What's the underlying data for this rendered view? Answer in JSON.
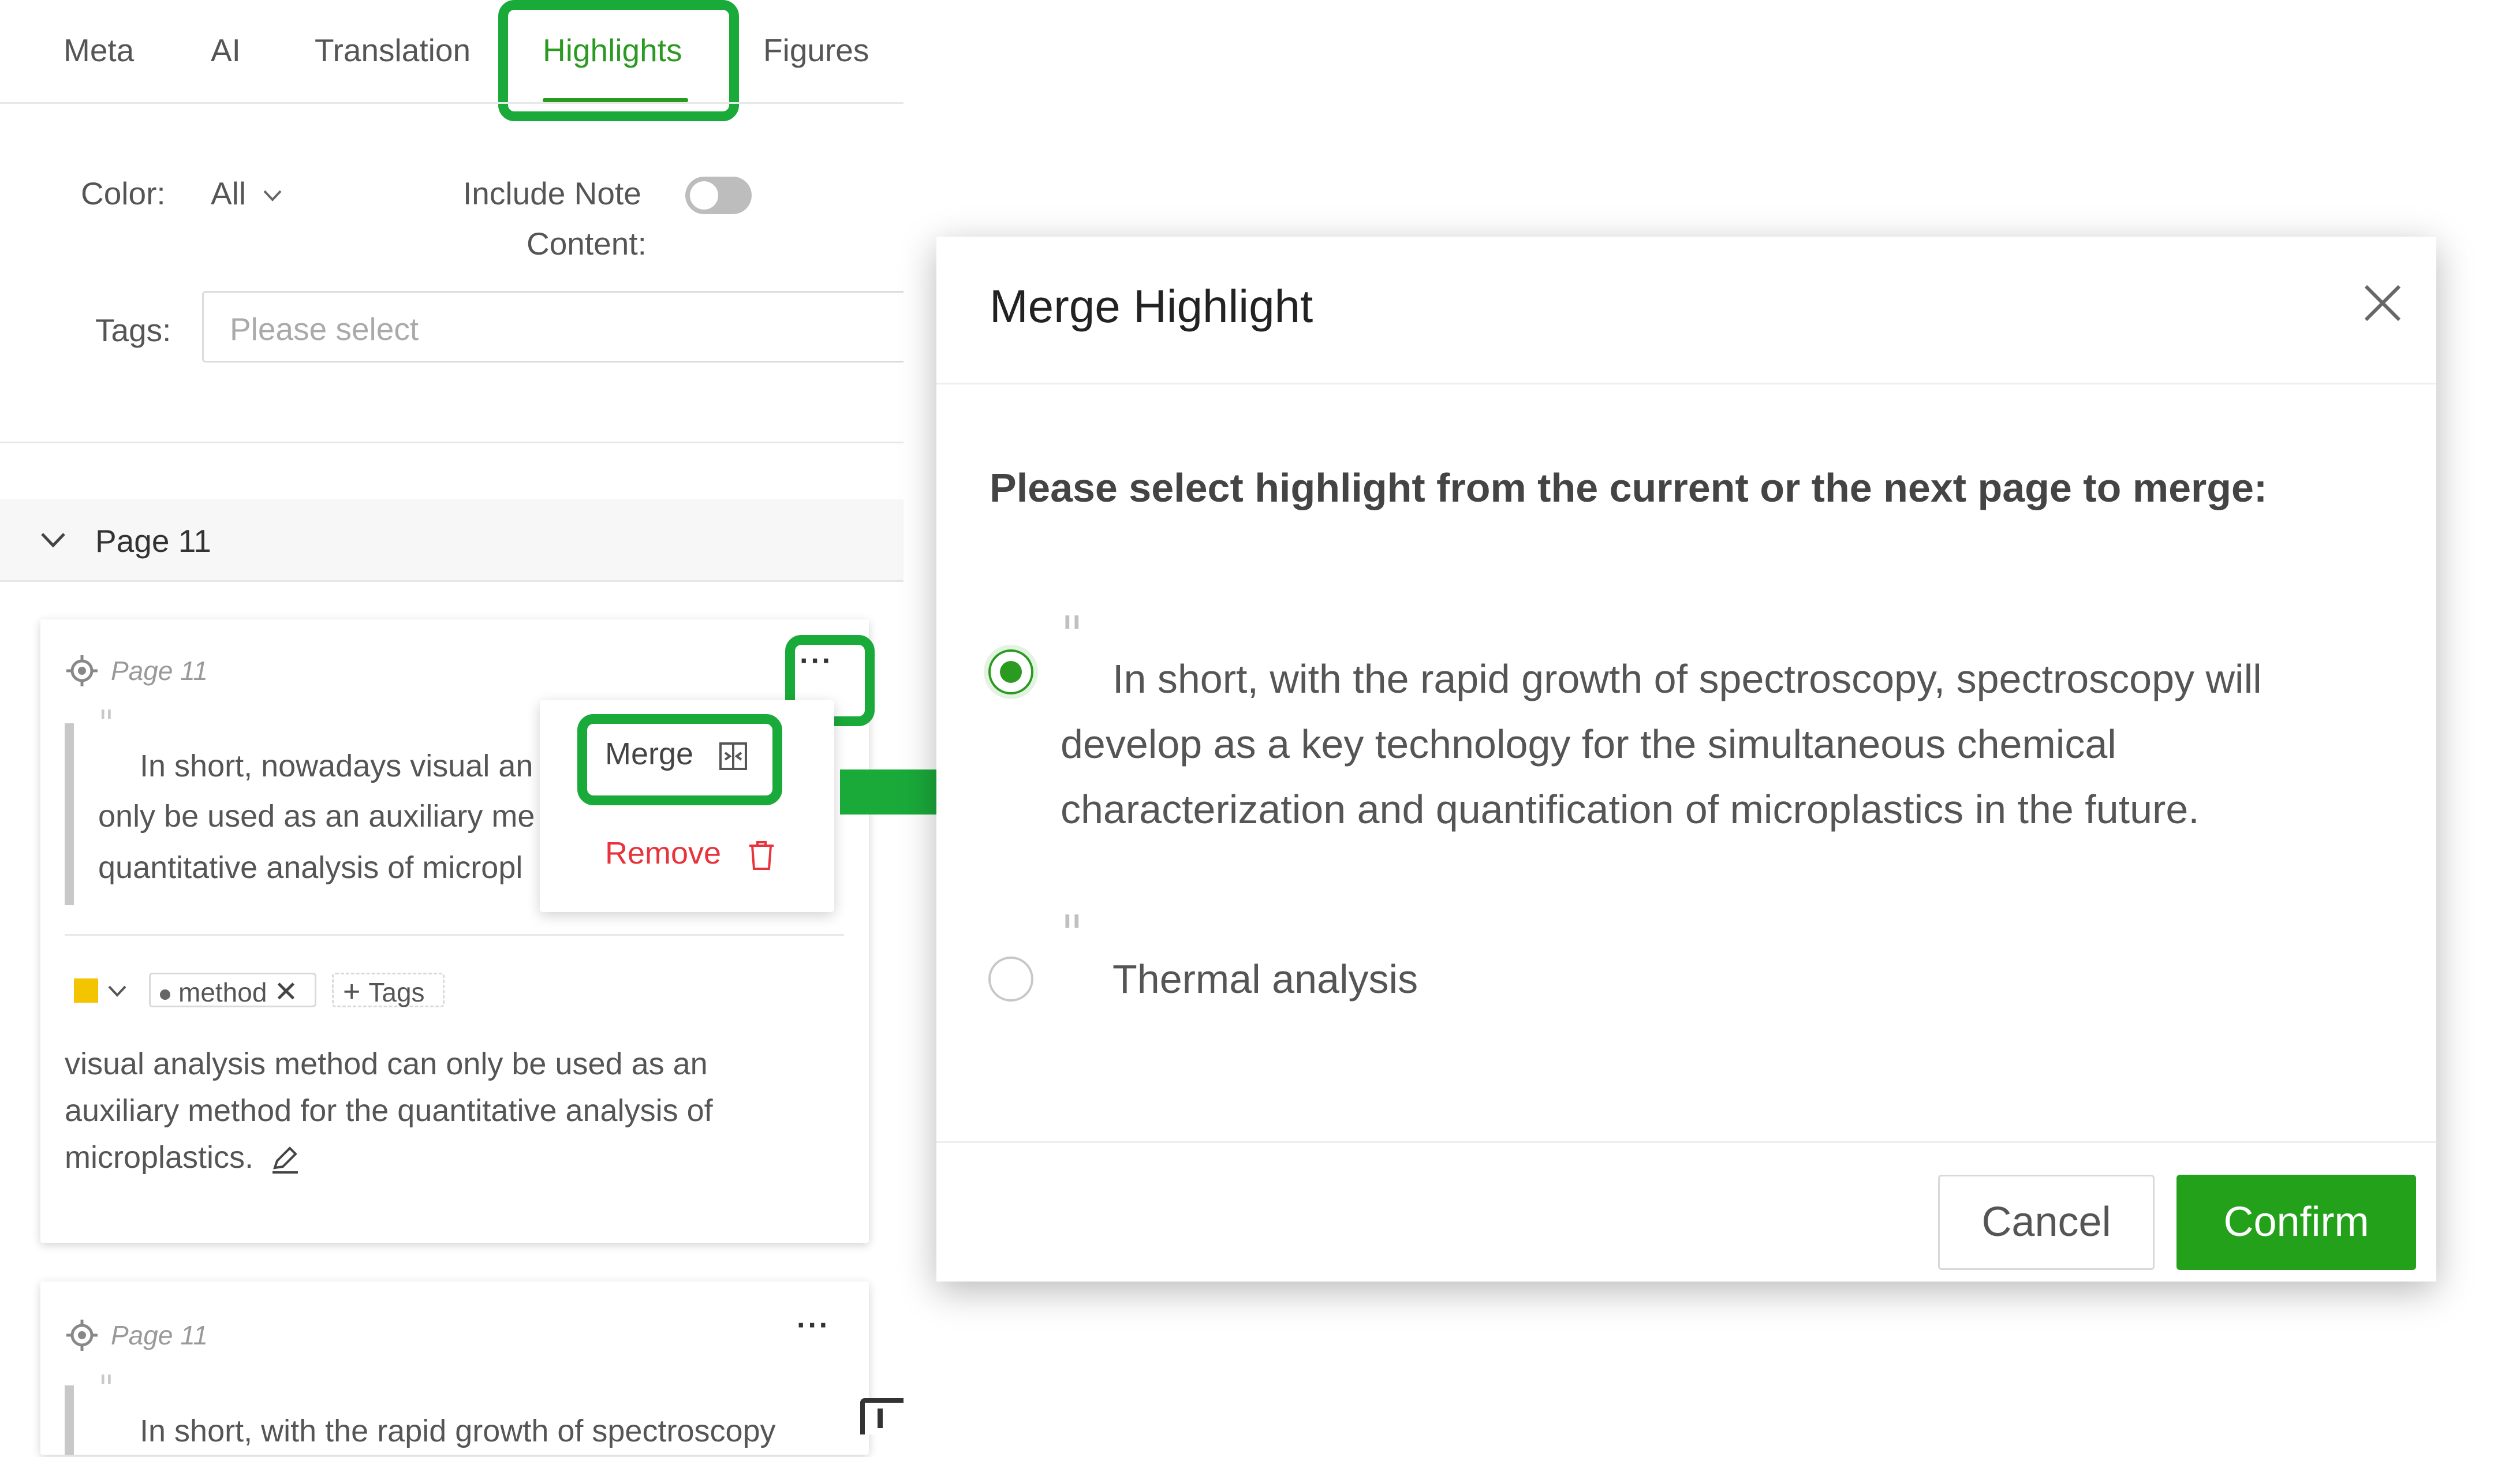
{
  "tabs": [
    "Meta",
    "AI",
    "Translation",
    "Highlights",
    "Figures"
  ],
  "active_tab": "Highlights",
  "filters": {
    "color_label": "Color:",
    "color_value": "All",
    "include_note_label_line1": "Include Note",
    "include_note_label_line2": "Content:",
    "include_note_on": false,
    "tags_label": "Tags:",
    "tags_placeholder": "Please select"
  },
  "page_group": {
    "label": "Page 11"
  },
  "cards": [
    {
      "page_ref": "Page 11",
      "quote_lines": [
        "In short, nowadays visual an",
        "only be used as an auxiliary me",
        "quantitative analysis of micropl"
      ],
      "color": "#f5c400",
      "tag": "method",
      "add_tags_label": "Tags",
      "note_lines": [
        "visual analysis method can only be used as an",
        "auxiliary method for the quantitative analysis of",
        "microplastics."
      ]
    },
    {
      "page_ref": "Page 11",
      "quote_lines": [
        "In short, with the rapid growth of spectroscopy"
      ]
    }
  ],
  "menu": {
    "merge_label": "Merge",
    "remove_label": "Remove"
  },
  "dialog": {
    "title": "Merge Highlight",
    "prompt": "Please select highlight from the current or the next page to merge:",
    "options": [
      {
        "selected": true,
        "lines": [
          "In short, with the rapid growth of spectroscopy, spectroscopy will",
          "develop as a key technology for the simultaneous chemical",
          "characterization and quantification of microplastics in the future."
        ]
      },
      {
        "selected": false,
        "lines": [
          "Thermal analysis"
        ]
      }
    ],
    "cancel_label": "Cancel",
    "confirm_label": "Confirm"
  },
  "colors": {
    "accent": "#2b9a21",
    "annotation": "#1aaa3a",
    "danger": "#e8323c",
    "confirm_bg": "#24a11a"
  }
}
